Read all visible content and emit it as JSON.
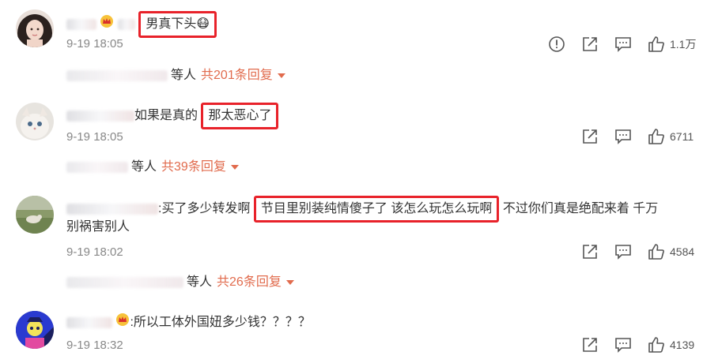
{
  "comments": [
    {
      "text": "男真下头😷",
      "time": "9-19 18:05",
      "likes": "1.1万",
      "has_report": true,
      "reply_who": "等人",
      "reply_count": "共201条回复"
    },
    {
      "text_prefix": "如果是真的",
      "text_highlight": "那太恶心了",
      "time": "9-19 18:05",
      "likes": "6711",
      "reply_who": "等人",
      "reply_count": "共39条回复"
    },
    {
      "text_prefix": ":买了多少转发啊",
      "text_highlight": "节目里别装纯情傻子了 该怎么玩怎么玩啊",
      "text_suffix": "不过你们真是绝配来着 千万",
      "text_line2": "别祸害别人",
      "time": "9-19 18:02",
      "likes": "4584",
      "reply_who": "等人",
      "reply_count": "共26条回复"
    },
    {
      "text": ":所以工体外国妞多少钱？？？？",
      "time": "9-19 18:32",
      "likes": "4139"
    }
  ],
  "icons": {
    "report": "report-icon",
    "share": "share-icon",
    "comment": "comment-icon",
    "like": "like-icon",
    "crown": "crown-badge-icon",
    "caret": "caret-down-icon"
  },
  "colors": {
    "highlight_box": "#e8222a",
    "reply_count": "#e16b4d",
    "meta_text": "#888888"
  }
}
